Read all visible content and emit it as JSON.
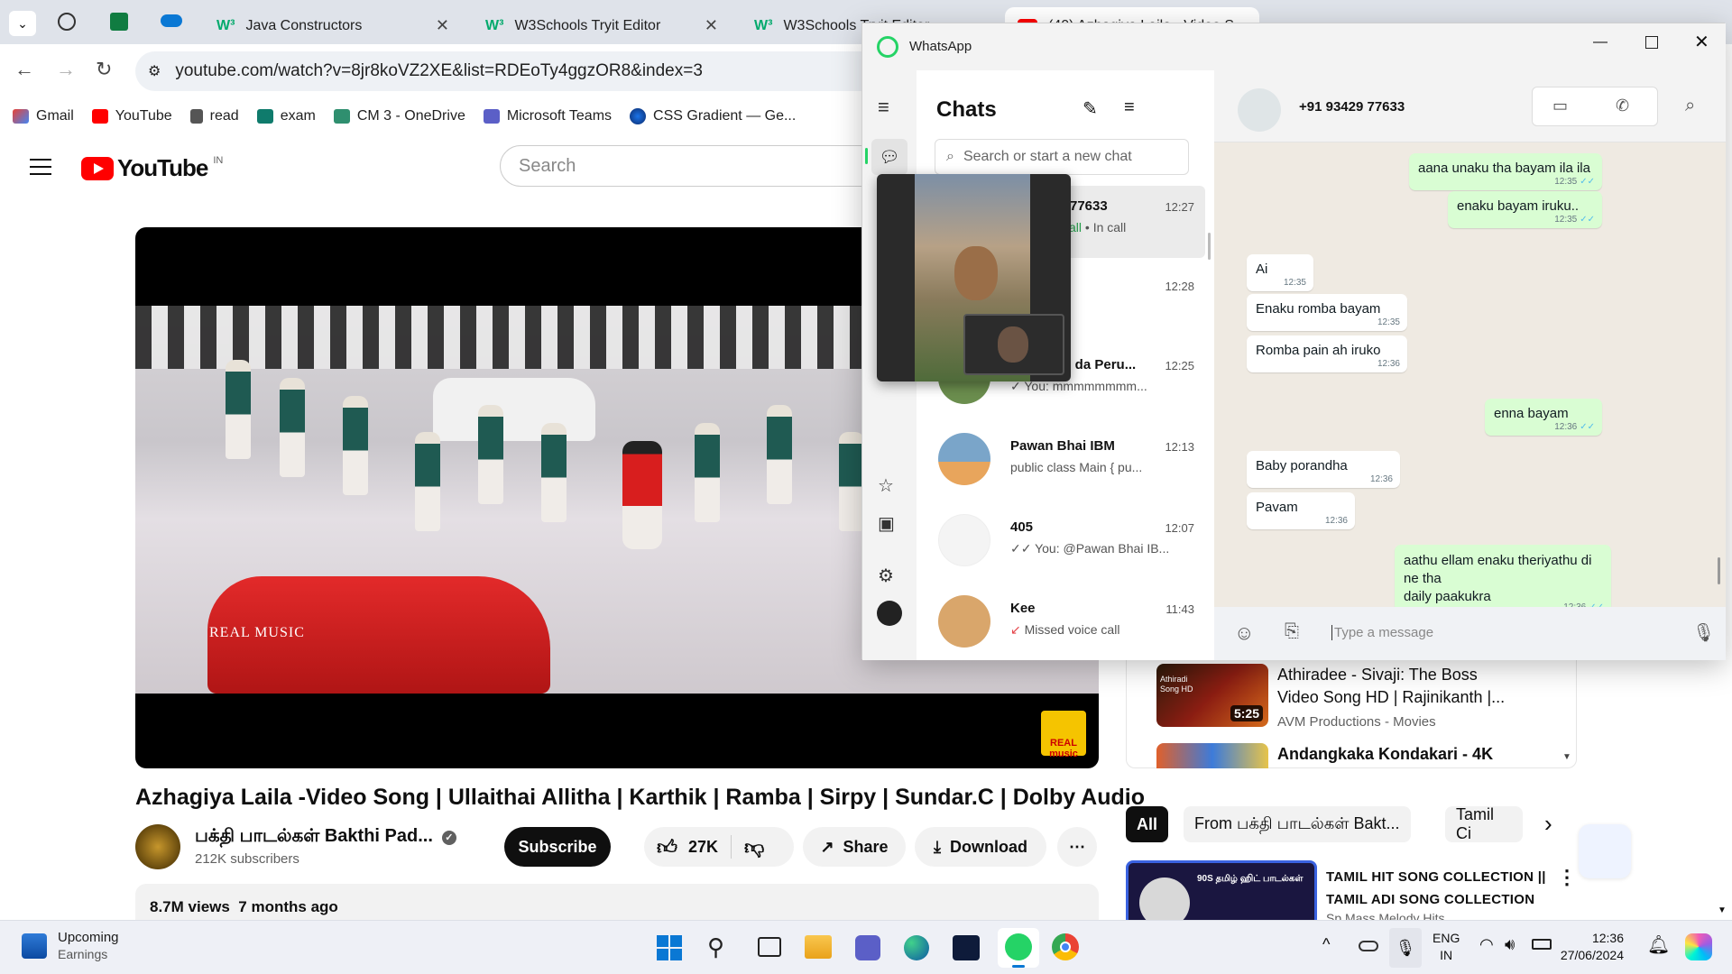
{
  "browser": {
    "tabs": [
      {
        "label": "Java Constructors",
        "brand": "W³"
      },
      {
        "label": "W3Schools Tryit Editor",
        "brand": "W³"
      },
      {
        "label": "W3Schools Tryit Editor",
        "brand": "W³"
      },
      {
        "label": "(40) Azhagiya Laila - Video S"
      }
    ],
    "url": "youtube.com/watch?v=8jr8koVZ2XE&list=RDEoTy4ggzOR8&index=3",
    "bookmarks": [
      "Gmail",
      "YouTube",
      "read",
      "exam",
      "CM 3 - OneDrive",
      "Microsoft Teams",
      "CSS Gradient — Ge..."
    ]
  },
  "youtube": {
    "logo": "YouTube",
    "region": "IN",
    "search_placeholder": "Search",
    "video_watermark": "REAL MUSIC",
    "video_badge": "REAL music",
    "title": "Azhagiya Laila -Video Song | Ullaithai Allitha | Karthik | Ramba | Sirpy | Sundar.C | Dolby Audio",
    "channel_name": "பக்தி பாடல்கள் Bakthi Pad...",
    "subscribers": "212K subscribers",
    "subscribe": "Subscribe",
    "likes": "27K",
    "share": "Share",
    "download": "Download",
    "views": "8.7M views",
    "age": "7 months ago",
    "chips": [
      "All",
      "From பக்தி பாடல்கள் Bakt...",
      "Tamil Ci"
    ],
    "recs": [
      {
        "title_line1": "Athiradee - Sivaji: The Boss",
        "title_line2": "Video Song HD | Rajinikanth |...",
        "channel": "AVM Productions - Movies",
        "duration": "5:25",
        "thumb_text": "Athiradi Song HD"
      },
      {
        "title_line1": "Andangkaka Kondakari - 4K"
      }
    ],
    "playlist_title_line1": "TAMIL HIT SONG COLLECTION ||",
    "playlist_title_line2": "TAMIL ADI SONG COLLECTION",
    "playlist_channel": "Sp Mass Melody Hits",
    "playlist_thumb_text": "90S தமிழ் ஹிட் பாடல்கள்"
  },
  "whatsapp": {
    "app_title": "WhatsApp",
    "list_title": "Chats",
    "search_placeholder": "Search or start a new chat",
    "chats": [
      {
        "name": "77633",
        "preview_status": "call",
        "preview": "• In call",
        "time": "12:27",
        "avatar_color": "#d7d7d7"
      },
      {
        "name": "",
        "preview": "y",
        "time": "12:28",
        "avatar_color": "#8fb8d8"
      },
      {
        "name": "Eathukku da Peru...",
        "preview": "✓ You: mmmmmmmm...",
        "time": "12:25",
        "avatar_color": "#6b8e4e"
      },
      {
        "name": "Pawan Bhai IBM",
        "preview": "public class Main {     pu...",
        "time": "12:13",
        "avatar_color": "#e8a55c"
      },
      {
        "name": "405",
        "preview": "✓✓ You: @Pawan Bhai IB...",
        "time": "12:07",
        "avatar_color": "#f4f4f4"
      },
      {
        "name": "Kee",
        "preview": "Missed voice call",
        "time": "11:43",
        "avatar_color": "#d9a66b"
      }
    ],
    "contact": "+91 93429 77633",
    "messages": [
      {
        "dir": "out",
        "text": "aana unaku tha bayam ila ila",
        "time": "12:35"
      },
      {
        "dir": "out",
        "text": "enaku bayam iruku..",
        "time": "12:35"
      },
      {
        "dir": "in",
        "text": "Ai",
        "time": "12:35"
      },
      {
        "dir": "in",
        "text": "Enaku romba bayam",
        "time": "12:35"
      },
      {
        "dir": "in",
        "text": "Romba pain ah iruko",
        "time": "12:36"
      },
      {
        "dir": "out",
        "text": "enna bayam",
        "time": "12:36"
      },
      {
        "dir": "in",
        "text": "Baby porandha",
        "time": "12:36"
      },
      {
        "dir": "in",
        "text": "Pavam",
        "time": "12:36"
      },
      {
        "dir": "out",
        "text_line1": "aathu ellam enaku theriyathu di ne tha",
        "text_line2": "daily paakukra",
        "time": "12:36"
      }
    ],
    "input_placeholder": "Type a message"
  },
  "taskbar": {
    "widget_title": "Upcoming",
    "widget_sub": "Earnings",
    "lang_line1": "ENG",
    "lang_line2": "IN",
    "time": "12:36",
    "date": "27/06/2024"
  }
}
